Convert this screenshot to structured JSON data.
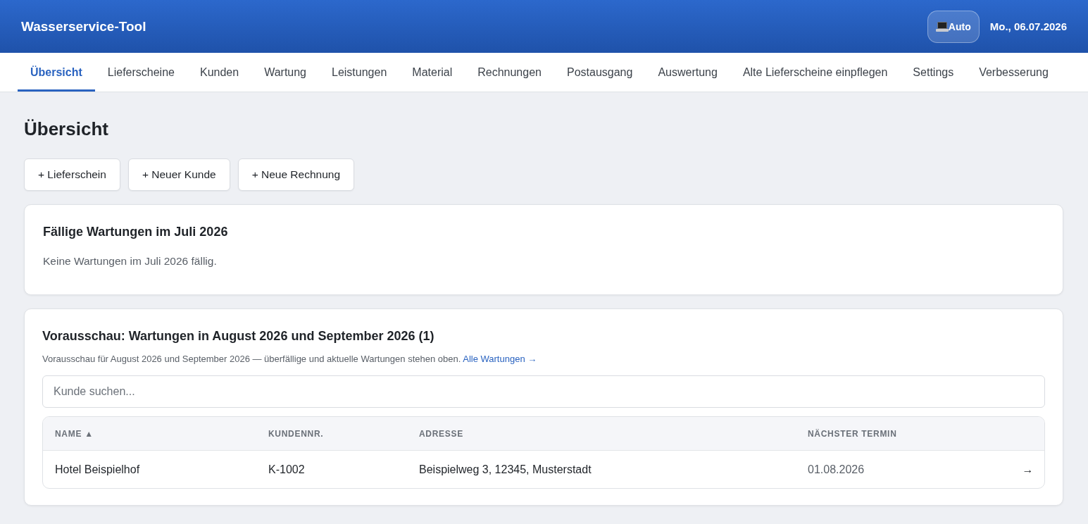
{
  "header": {
    "title": "Wasserservice-Tool",
    "theme_button": {
      "label": "Auto"
    },
    "date": "Mo., 06.07.2026"
  },
  "tabs": [
    {
      "label": "Übersicht",
      "selected": true
    },
    {
      "label": "Lieferscheine",
      "selected": false
    },
    {
      "label": "Kunden",
      "selected": false
    },
    {
      "label": "Wartung",
      "selected": false
    },
    {
      "label": "Leistungen",
      "selected": false
    },
    {
      "label": "Material",
      "selected": false
    },
    {
      "label": "Rechnungen",
      "selected": false
    },
    {
      "label": "Postausgang",
      "selected": false
    },
    {
      "label": "Auswertung",
      "selected": false
    },
    {
      "label": "Alte Lieferscheine einpflegen",
      "selected": false
    },
    {
      "label": "Settings",
      "selected": false
    },
    {
      "label": "Verbesserung",
      "selected": false
    }
  ],
  "page": {
    "title": "Übersicht"
  },
  "actions": [
    "+ Lieferschein",
    "+ Neuer Kunde",
    "+ Neue Rechnung"
  ],
  "due_card": {
    "title": "Fällige Wartungen im Juli 2026",
    "message": "Keine Wartungen im Juli 2026 fällig."
  },
  "preview_card": {
    "title": "Vorausschau: Wartungen in August 2026 und September 2026 (1)",
    "description": "Vorausschau für August 2026 und September 2026 — überfällige und aktuelle Wartungen stehen oben.",
    "link": "Alle Wartungen →",
    "search": {
      "placeholder": "Kunde suchen..."
    },
    "table": {
      "columns": [
        "NAME ▲",
        "KUNDENNR.",
        "ADRESSE",
        "NÄCHSTER TERMIN"
      ],
      "rows": [
        {
          "cells": [
            "Hotel Beispielhof",
            "K-1002",
            "Beispielweg 3, 12345, Musterstadt",
            "01.08.2026"
          ],
          "action": "→"
        }
      ]
    }
  }
}
